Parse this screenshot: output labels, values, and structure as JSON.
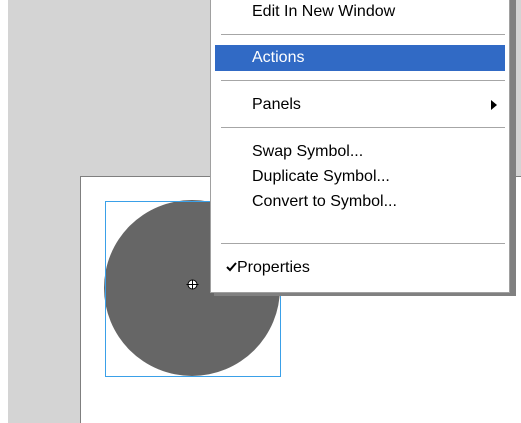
{
  "context_menu": {
    "items": [
      {
        "label": "Edit In New Window"
      },
      {
        "label": "Actions"
      },
      {
        "label": "Panels"
      },
      {
        "label": "Swap Symbol..."
      },
      {
        "label": "Duplicate Symbol..."
      },
      {
        "label": "Convert to Symbol..."
      },
      {
        "label": "Properties"
      }
    ],
    "highlighted_item": "Actions",
    "checked_item": "Properties"
  },
  "icons": {
    "submenu": "chevron-right-icon",
    "check": "checkmark-icon",
    "registration": "registration-point-icon"
  },
  "colors": {
    "highlight": "#316ac5",
    "selection": "#3aa0e8",
    "symbol_fill": "#666666",
    "workspace": "#d4d4d4"
  }
}
